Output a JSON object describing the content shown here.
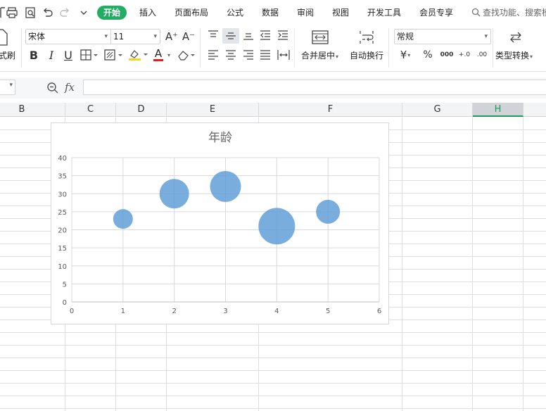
{
  "menubar": {
    "items": [
      "开始",
      "插入",
      "页面布局",
      "公式",
      "数据",
      "审阅",
      "视图",
      "开发工具",
      "会员专享"
    ],
    "active_index": 0,
    "search_text": "查找功能、搜索模"
  },
  "ribbon": {
    "format_painter_label": "式刷",
    "font_name": "宋体",
    "font_size": "11",
    "increase_font": "A⁺",
    "decrease_font": "A⁻",
    "bold": "B",
    "italic": "I",
    "underline": "U",
    "font_color_letter": "A",
    "merge_center_label": "合并居中",
    "wrap_text_label": "自动换行",
    "number_format": "常规",
    "currency_symbol": "¥",
    "percent_symbol": "%",
    "thousands_symbol": "000",
    "increase_decimal": "+.0",
    "decrease_decimal": ".00",
    "type_convert_label": "类型转换",
    "accent_color": "#23ad64",
    "font_color": "#e02020",
    "highlight_color": "#f5d320"
  },
  "formula_bar": {
    "fx_label": "fx",
    "value": ""
  },
  "columns": [
    "B",
    "C",
    "D",
    "E",
    "F",
    "G",
    "H"
  ],
  "selected_column": "H",
  "chart_data": {
    "type": "bubble",
    "title": "年龄",
    "xlim": [
      0,
      6
    ],
    "ylim": [
      0,
      40
    ],
    "x_ticks": [
      "0",
      "1",
      "2",
      "3",
      "4",
      "5",
      "6"
    ],
    "y_ticks": [
      "0",
      "5",
      "10",
      "15",
      "20",
      "25",
      "30",
      "35",
      "40"
    ],
    "points": [
      {
        "x": 1,
        "y": 23,
        "size": 14
      },
      {
        "x": 2,
        "y": 30,
        "size": 21
      },
      {
        "x": 3,
        "y": 32,
        "size": 22
      },
      {
        "x": 4,
        "y": 21,
        "size": 26
      },
      {
        "x": 5,
        "y": 25,
        "size": 17
      }
    ],
    "grid": true,
    "bubble_color": "#5b9bd5"
  }
}
